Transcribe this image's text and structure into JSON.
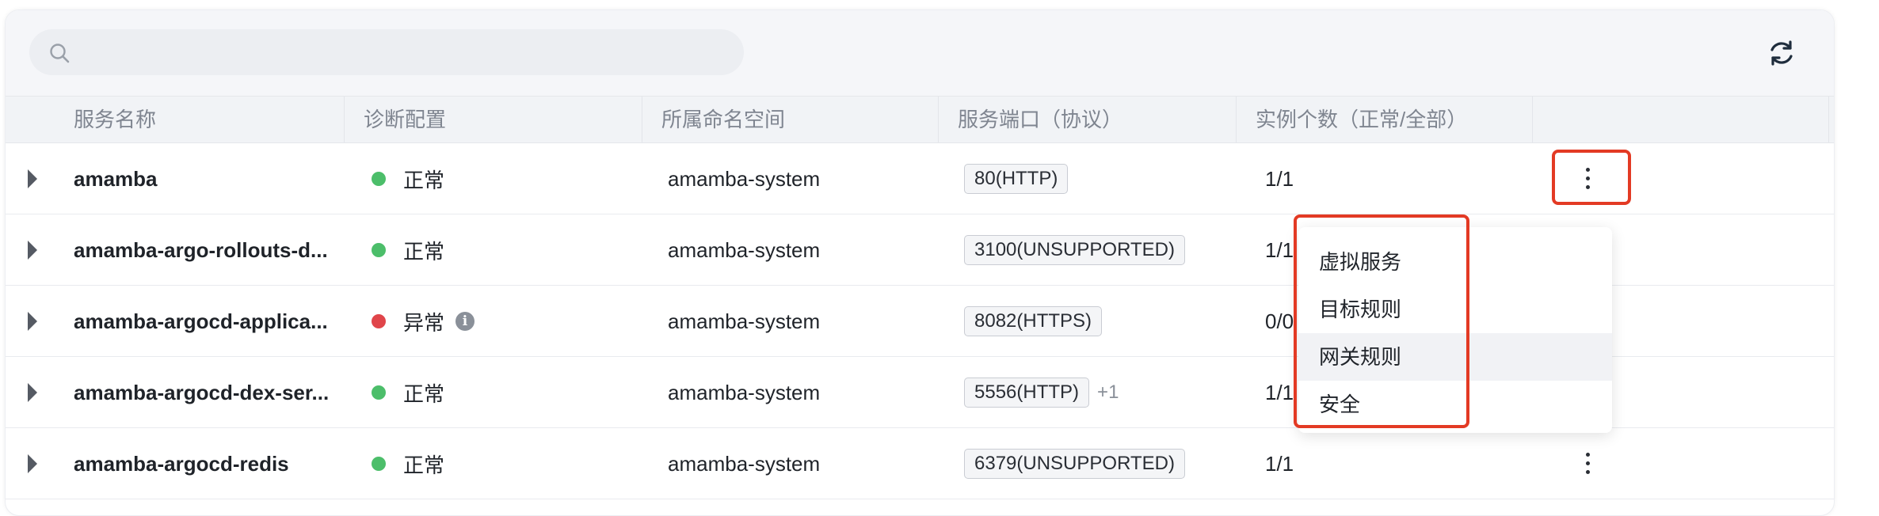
{
  "search": {
    "value": "",
    "placeholder": ""
  },
  "columns": [
    "服务名称",
    "诊断配置",
    "所属命名空间",
    "服务端口（协议）",
    "实例个数（正常/全部）",
    ""
  ],
  "rows": [
    {
      "name": "amamba",
      "status": "正常",
      "status_color": "#4cbe6a",
      "namespace": "amamba-system",
      "port": "80(HTTP)",
      "extra_ports": "",
      "instances": "1/1",
      "show_info": false
    },
    {
      "name": "amamba-argo-rollouts-d...",
      "status": "正常",
      "status_color": "#4cbe6a",
      "namespace": "amamba-system",
      "port": "3100(UNSUPPORTED)",
      "extra_ports": "",
      "instances": "1/1",
      "show_info": false
    },
    {
      "name": "amamba-argocd-applica...",
      "status": "异常",
      "status_color": "#e0454a",
      "namespace": "amamba-system",
      "port": "8082(HTTPS)",
      "extra_ports": "",
      "instances": "0/0",
      "show_info": true
    },
    {
      "name": "amamba-argocd-dex-ser...",
      "status": "正常",
      "status_color": "#4cbe6a",
      "namespace": "amamba-system",
      "port": "5556(HTTP)",
      "extra_ports": "+1",
      "instances": "1/1",
      "show_info": false
    },
    {
      "name": "amamba-argocd-redis",
      "status": "正常",
      "status_color": "#4cbe6a",
      "namespace": "amamba-system",
      "port": "6379(UNSUPPORTED)",
      "extra_ports": "",
      "instances": "1/1",
      "show_info": false
    }
  ],
  "menu": {
    "items": [
      "虚拟服务",
      "目标规则",
      "网关规则",
      "安全"
    ],
    "active_index": 2
  },
  "icons": {
    "search": "search-icon",
    "refresh": "refresh-icon",
    "expand": "caret-right-icon",
    "more": "more-vertical-icon",
    "info": "info-icon"
  },
  "colors": {
    "highlight": "#e33a24",
    "ok": "#4cbe6a",
    "error": "#e0454a"
  }
}
